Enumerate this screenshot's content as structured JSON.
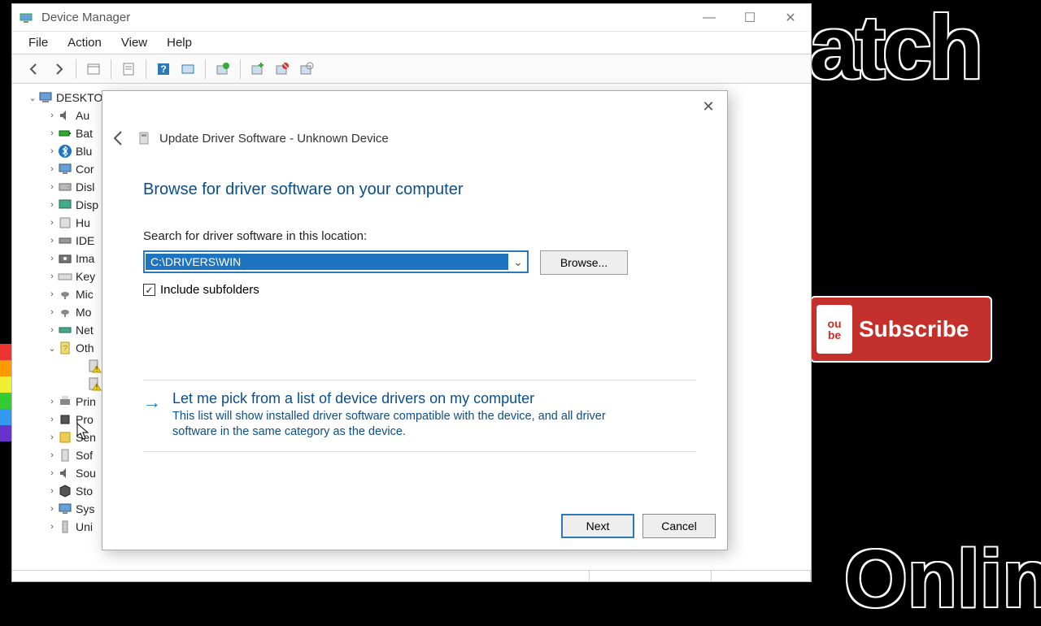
{
  "window": {
    "title": "Device Manager",
    "minimize": "—",
    "maximize": "☐",
    "close": "✕"
  },
  "menu": {
    "file": "File",
    "action": "Action",
    "view": "View",
    "help": "Help"
  },
  "tree": {
    "root": "DESKTO",
    "items": [
      {
        "label": "Au",
        "exp": ">"
      },
      {
        "label": "Bat",
        "exp": ">"
      },
      {
        "label": "Blu",
        "exp": ">"
      },
      {
        "label": "Cor",
        "exp": ">"
      },
      {
        "label": "Disl",
        "exp": ">"
      },
      {
        "label": "Disp",
        "exp": ">"
      },
      {
        "label": "Hu",
        "exp": ">"
      },
      {
        "label": "IDE",
        "exp": ">"
      },
      {
        "label": "Ima",
        "exp": ">"
      },
      {
        "label": "Key",
        "exp": ">"
      },
      {
        "label": "Mic",
        "exp": ">"
      },
      {
        "label": "Mo",
        "exp": ">"
      },
      {
        "label": "Net",
        "exp": ">"
      },
      {
        "label": "Oth",
        "exp": "v"
      },
      {
        "label": "",
        "exp": "",
        "child": true
      },
      {
        "label": "",
        "exp": "",
        "child": true
      },
      {
        "label": "Prin",
        "exp": ">"
      },
      {
        "label": "Pro",
        "exp": ">"
      },
      {
        "label": "Sen",
        "exp": ">"
      },
      {
        "label": "Sof",
        "exp": ">"
      },
      {
        "label": "Sou",
        "exp": ">"
      },
      {
        "label": "Sto",
        "exp": ">"
      },
      {
        "label": "Sys",
        "exp": ">"
      },
      {
        "label": "Uni",
        "exp": ">"
      }
    ]
  },
  "dialog": {
    "title": "Update Driver Software - Unknown Device",
    "heading": "Browse for driver software on your computer",
    "search_label": "Search for driver software in this location:",
    "path_value": "C:\\DRIVERS\\WIN",
    "browse_label": "Browse...",
    "include_subfolders": "Include subfolders",
    "include_checked": true,
    "option_title": "Let me pick from a list of device drivers on my computer",
    "option_desc": "This list will show installed driver software compatible with the device, and all driver software in the same category as the device.",
    "next": "Next",
    "cancel": "Cancel",
    "close": "✕"
  },
  "subscribe": {
    "label": "Subscribe",
    "ou": "ou",
    "be": "be"
  },
  "bg": {
    "t1": "atch",
    "t2": "Onlin"
  }
}
